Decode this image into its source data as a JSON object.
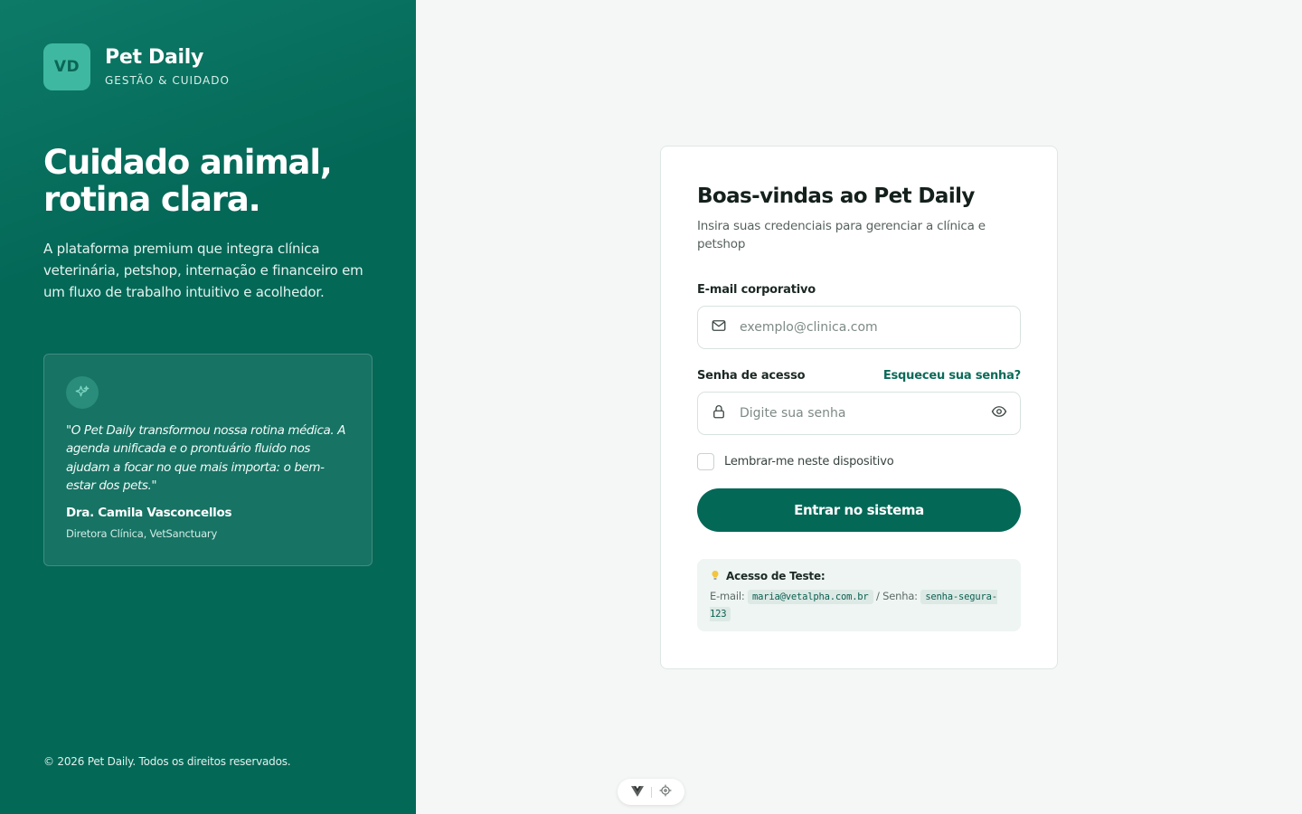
{
  "brand": {
    "logo_initials": "VD",
    "name": "Pet Daily",
    "tagline": "GESTÃO & CUIDADO"
  },
  "hero": {
    "headline": "Cuidado animal, rotina clara.",
    "lead": "A plataforma premium que integra clínica veterinária, petshop, internação e financeiro em um fluxo de trabalho intuitivo e acolhedor."
  },
  "testimonial": {
    "icon": "sparkle-icon",
    "quote": "\"O Pet Daily transformou nossa rotina médica. A agenda unificada e o prontuário fluido nos ajudam a focar no que mais importa: o bem-estar dos pets.\"",
    "author": "Dra. Camila Vasconcellos",
    "role": "Diretora Clínica, VetSanctuary"
  },
  "footer": {
    "copyright": "© 2026 Pet Daily. Todos os direitos reservados."
  },
  "login": {
    "title": "Boas-vindas ao Pet Daily",
    "subtitle": "Insira suas credenciais para gerenciar a clínica e petshop",
    "email_label": "E-mail corporativo",
    "email_placeholder": "exemplo@clinica.com",
    "email_value": "",
    "password_label": "Senha de acesso",
    "forgot_link": "Esqueceu sua senha?",
    "password_placeholder": "Digite sua senha",
    "password_value": "",
    "remember_label": "Lembrar-me neste dispositivo",
    "submit_label": "Entrar no sistema"
  },
  "test_access": {
    "title": "Acesso de Teste:",
    "email_prefix": "E-mail:",
    "email": "maria@vetalpha.com.br",
    "separator": "/ Senha:",
    "password": "senha-segura-123"
  },
  "colors": {
    "primary": "#046857",
    "accent": "#3fb8a1",
    "background": "#f4f7f6"
  }
}
